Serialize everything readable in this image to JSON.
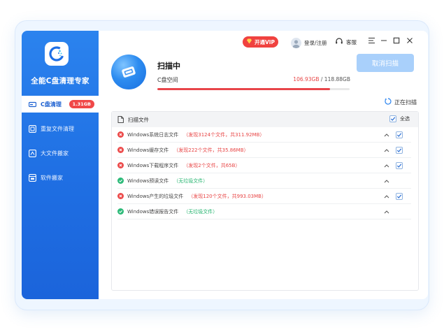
{
  "app": {
    "title": "全能C盘清理专家"
  },
  "sidebar": {
    "items": [
      {
        "label": "C盘清理",
        "badge": "1.31GB",
        "active": true,
        "icon": "disk-icon"
      },
      {
        "label": "重复文件清理",
        "icon": "duplicate-file-icon"
      },
      {
        "label": "大文件搬家",
        "icon": "large-file-icon"
      },
      {
        "label": "软件搬家",
        "icon": "software-move-icon"
      }
    ]
  },
  "topbar": {
    "vip_label": "开通VIP",
    "login_label": "登录/注册",
    "service_label": "客服"
  },
  "scan": {
    "title": "扫描中",
    "space_label": "C盘空间",
    "used": "106.93GB",
    "separator": " / ",
    "total": "118.88GB",
    "usage_fraction": 0.899,
    "cancel_label": "取消扫描",
    "status_label": "正在扫描"
  },
  "table": {
    "header_label": "扫描文件",
    "select_all_label": "全选",
    "rows": [
      {
        "name": "Windows系统日志文件",
        "detail": "（发现3124个文件，共311.92MB）",
        "status": "error",
        "checked": true
      },
      {
        "name": "Windows缓存文件",
        "detail": "（发现222个文件，共35.86MB）",
        "status": "error",
        "checked": true
      },
      {
        "name": "Windows下载程序文件",
        "detail": "（发现2个文件，共65B）",
        "status": "error",
        "checked": true
      },
      {
        "name": "Windows预读文件",
        "detail": "（无垃圾文件）",
        "status": "clean",
        "checked": false
      },
      {
        "name": "Windows产生的垃圾文件",
        "detail": "（发现120个文件，共993.03MB）",
        "status": "error",
        "checked": true
      },
      {
        "name": "Windows错误报告文件",
        "detail": "（无垃圾文件）",
        "status": "clean",
        "checked": false
      }
    ]
  },
  "colors": {
    "sidebar": "#1f6fe3",
    "accent_red": "#e8454a",
    "clean_green": "#22b36d",
    "cancel_button": "#a9d0fb"
  }
}
